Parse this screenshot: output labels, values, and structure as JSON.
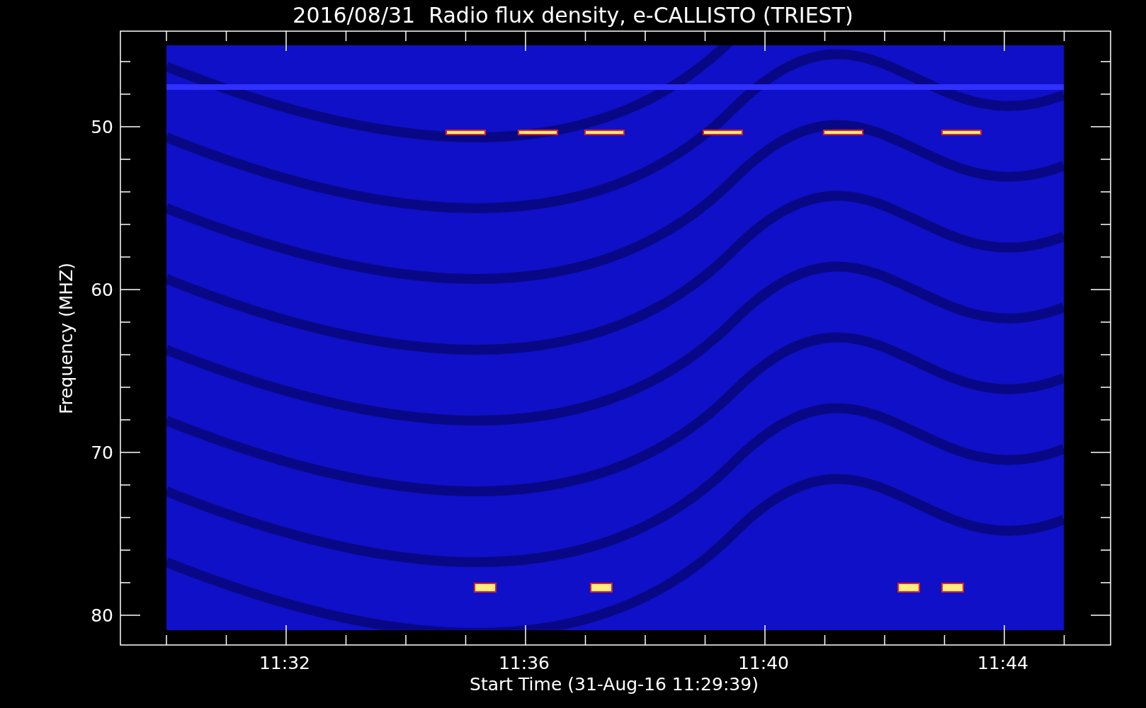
{
  "title": "2016/08/31  Radio flux density, e-CALLISTO (TRIEST)",
  "y_axis": {
    "label": "Frequency (MHZ)",
    "ticks": [
      "50",
      "60",
      "70",
      "80"
    ]
  },
  "x_axis": {
    "label": "Start Time (31-Aug-16 11:29:39)",
    "ticks": [
      "11:32",
      "11:36",
      "11:40",
      "11:44"
    ]
  }
}
